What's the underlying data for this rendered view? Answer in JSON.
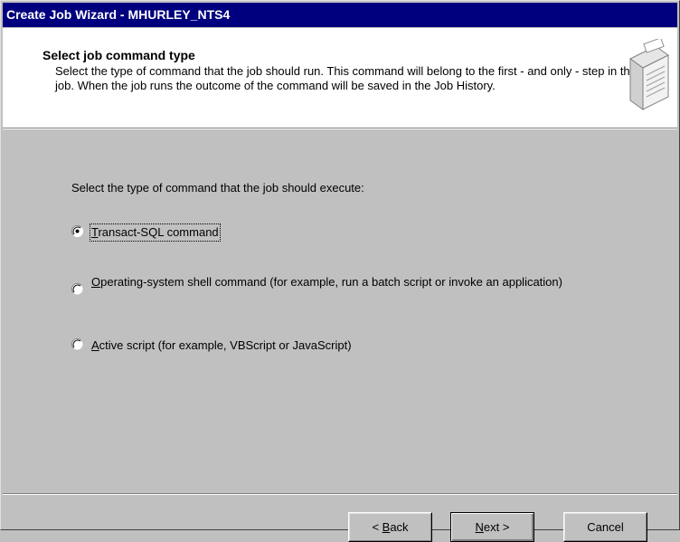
{
  "window": {
    "title": "Create Job Wizard - MHURLEY_NTS4"
  },
  "header": {
    "title": "Select job command type",
    "description": "Select the type of command that the job should run.  This command will belong to the first - and only - step in the job.  When the job runs the outcome of the command will be saved in the Job History.",
    "icon": "wizard-server-icon"
  },
  "main": {
    "prompt": "Select the type of command that the job should execute:",
    "options": [
      {
        "mnemonic": "T",
        "rest": "ransact-SQL command",
        "selected": true
      },
      {
        "mnemonic": "O",
        "rest": "perating-system shell command (for example, run a batch script or invoke an application)",
        "selected": false
      },
      {
        "mnemonic": "A",
        "rest": "ctive script (for example, VBScript or JavaScript)",
        "selected": false
      }
    ]
  },
  "footer": {
    "back_pre": "< ",
    "back_mn": "B",
    "back_post": "ack",
    "next_mn": "N",
    "next_post": "ext >",
    "cancel": "Cancel"
  }
}
